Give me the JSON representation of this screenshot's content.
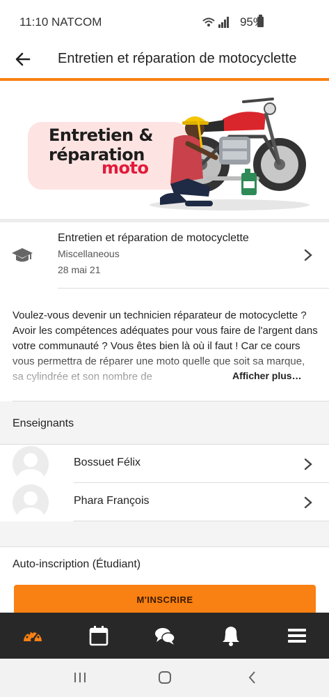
{
  "status_bar": {
    "time": "11:10 NATCOM",
    "battery": "95%"
  },
  "app_bar": {
    "title": "Entretien et réparation de motocyclette"
  },
  "hero": {
    "line1": "Entretien &",
    "line2": "réparation",
    "line3": "moto"
  },
  "course": {
    "name": "Entretien et réparation de motocyclette",
    "category": "Miscellaneous",
    "date": "28 mai 21"
  },
  "description": {
    "text": "Voulez-vous devenir un technicien réparateur de motocyclette ? Avoir les compétences adéquates pour vous faire de l'argent dans votre communauté ? Vous êtes bien là où il faut ! Car ce cours vous permettra de réparer une moto quelle que soit sa marque, sa cylindrée et son nombre de",
    "show_more": "Afficher plus…"
  },
  "teachers": {
    "heading": "Enseignants",
    "items": [
      {
        "name": "Bossuet Félix"
      },
      {
        "name": "Phara François"
      }
    ]
  },
  "enrolment": {
    "label": "Auto-inscription (Étudiant)",
    "button": "M'INSCRIRE"
  },
  "tabs": [
    "dashboard-icon",
    "calendar-icon",
    "messages-icon",
    "notifications-icon",
    "menu-icon"
  ],
  "colors": {
    "accent": "#f98012",
    "tabbar": "#282828",
    "hero_red": "#e21b3c"
  }
}
